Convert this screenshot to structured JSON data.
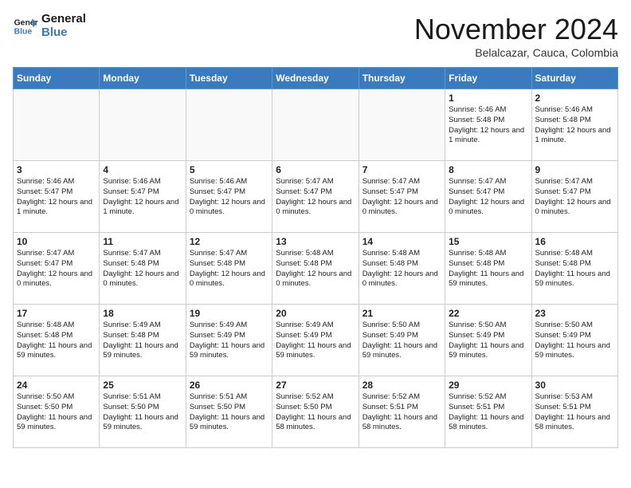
{
  "header": {
    "logo_line1": "General",
    "logo_line2": "Blue",
    "month": "November 2024",
    "location": "Belalcazar, Cauca, Colombia"
  },
  "weekdays": [
    "Sunday",
    "Monday",
    "Tuesday",
    "Wednesday",
    "Thursday",
    "Friday",
    "Saturday"
  ],
  "weeks": [
    [
      {
        "day": "",
        "info": ""
      },
      {
        "day": "",
        "info": ""
      },
      {
        "day": "",
        "info": ""
      },
      {
        "day": "",
        "info": ""
      },
      {
        "day": "",
        "info": ""
      },
      {
        "day": "1",
        "info": "Sunrise: 5:46 AM\nSunset: 5:48 PM\nDaylight: 12 hours and 1 minute."
      },
      {
        "day": "2",
        "info": "Sunrise: 5:46 AM\nSunset: 5:48 PM\nDaylight: 12 hours and 1 minute."
      }
    ],
    [
      {
        "day": "3",
        "info": "Sunrise: 5:46 AM\nSunset: 5:47 PM\nDaylight: 12 hours and 1 minute."
      },
      {
        "day": "4",
        "info": "Sunrise: 5:46 AM\nSunset: 5:47 PM\nDaylight: 12 hours and 1 minute."
      },
      {
        "day": "5",
        "info": "Sunrise: 5:46 AM\nSunset: 5:47 PM\nDaylight: 12 hours and 0 minutes."
      },
      {
        "day": "6",
        "info": "Sunrise: 5:47 AM\nSunset: 5:47 PM\nDaylight: 12 hours and 0 minutes."
      },
      {
        "day": "7",
        "info": "Sunrise: 5:47 AM\nSunset: 5:47 PM\nDaylight: 12 hours and 0 minutes."
      },
      {
        "day": "8",
        "info": "Sunrise: 5:47 AM\nSunset: 5:47 PM\nDaylight: 12 hours and 0 minutes."
      },
      {
        "day": "9",
        "info": "Sunrise: 5:47 AM\nSunset: 5:47 PM\nDaylight: 12 hours and 0 minutes."
      }
    ],
    [
      {
        "day": "10",
        "info": "Sunrise: 5:47 AM\nSunset: 5:47 PM\nDaylight: 12 hours and 0 minutes."
      },
      {
        "day": "11",
        "info": "Sunrise: 5:47 AM\nSunset: 5:48 PM\nDaylight: 12 hours and 0 minutes."
      },
      {
        "day": "12",
        "info": "Sunrise: 5:47 AM\nSunset: 5:48 PM\nDaylight: 12 hours and 0 minutes."
      },
      {
        "day": "13",
        "info": "Sunrise: 5:48 AM\nSunset: 5:48 PM\nDaylight: 12 hours and 0 minutes."
      },
      {
        "day": "14",
        "info": "Sunrise: 5:48 AM\nSunset: 5:48 PM\nDaylight: 12 hours and 0 minutes."
      },
      {
        "day": "15",
        "info": "Sunrise: 5:48 AM\nSunset: 5:48 PM\nDaylight: 11 hours and 59 minutes."
      },
      {
        "day": "16",
        "info": "Sunrise: 5:48 AM\nSunset: 5:48 PM\nDaylight: 11 hours and 59 minutes."
      }
    ],
    [
      {
        "day": "17",
        "info": "Sunrise: 5:48 AM\nSunset: 5:48 PM\nDaylight: 11 hours and 59 minutes."
      },
      {
        "day": "18",
        "info": "Sunrise: 5:49 AM\nSunset: 5:48 PM\nDaylight: 11 hours and 59 minutes."
      },
      {
        "day": "19",
        "info": "Sunrise: 5:49 AM\nSunset: 5:49 PM\nDaylight: 11 hours and 59 minutes."
      },
      {
        "day": "20",
        "info": "Sunrise: 5:49 AM\nSunset: 5:49 PM\nDaylight: 11 hours and 59 minutes."
      },
      {
        "day": "21",
        "info": "Sunrise: 5:50 AM\nSunset: 5:49 PM\nDaylight: 11 hours and 59 minutes."
      },
      {
        "day": "22",
        "info": "Sunrise: 5:50 AM\nSunset: 5:49 PM\nDaylight: 11 hours and 59 minutes."
      },
      {
        "day": "23",
        "info": "Sunrise: 5:50 AM\nSunset: 5:49 PM\nDaylight: 11 hours and 59 minutes."
      }
    ],
    [
      {
        "day": "24",
        "info": "Sunrise: 5:50 AM\nSunset: 5:50 PM\nDaylight: 11 hours and 59 minutes."
      },
      {
        "day": "25",
        "info": "Sunrise: 5:51 AM\nSunset: 5:50 PM\nDaylight: 11 hours and 59 minutes."
      },
      {
        "day": "26",
        "info": "Sunrise: 5:51 AM\nSunset: 5:50 PM\nDaylight: 11 hours and 59 minutes."
      },
      {
        "day": "27",
        "info": "Sunrise: 5:52 AM\nSunset: 5:50 PM\nDaylight: 11 hours and 58 minutes."
      },
      {
        "day": "28",
        "info": "Sunrise: 5:52 AM\nSunset: 5:51 PM\nDaylight: 11 hours and 58 minutes."
      },
      {
        "day": "29",
        "info": "Sunrise: 5:52 AM\nSunset: 5:51 PM\nDaylight: 11 hours and 58 minutes."
      },
      {
        "day": "30",
        "info": "Sunrise: 5:53 AM\nSunset: 5:51 PM\nDaylight: 11 hours and 58 minutes."
      }
    ]
  ]
}
